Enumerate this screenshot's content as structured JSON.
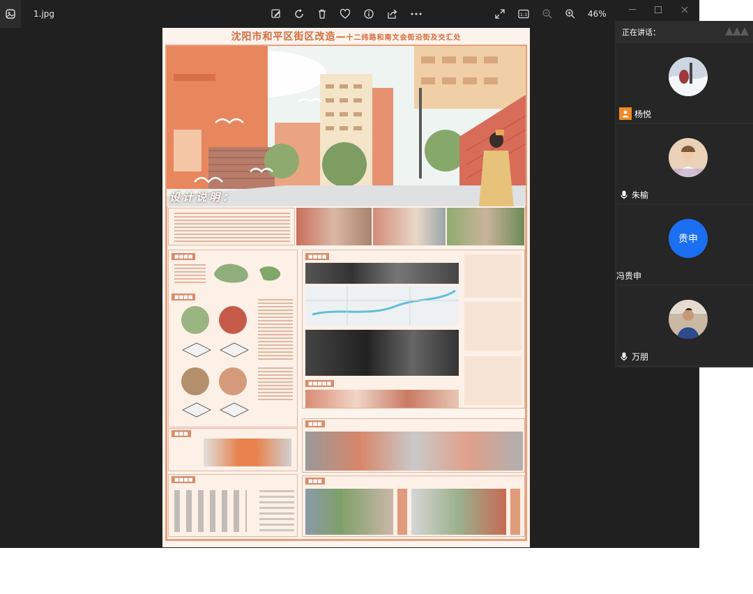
{
  "window": {
    "file_name": "1.jpg",
    "zoom_level": "46%",
    "icons": [
      "photos-app-icon",
      "edit-icon",
      "rotate-icon",
      "delete-icon",
      "favorite-icon",
      "info-icon",
      "share-icon",
      "more-icon",
      "fullscreen-icon",
      "actual-size-icon",
      "zoom-out-icon",
      "zoom-in-icon"
    ]
  },
  "poster": {
    "title_main": "沈阳市和平区街区改造",
    "title_dash": "—",
    "title_sub": "十二纬路和南文会街沿街及交汇处",
    "design_label": "设计说明："
  },
  "meeting": {
    "speaking_label": "正在讲话：",
    "participants": [
      {
        "name": "杨悦",
        "status_icon": "user-icon",
        "accent": "#f08a24"
      },
      {
        "name": "朱榆",
        "status_icon": "mic-icon"
      },
      {
        "name": "冯贵申",
        "avatar_text": "贵申",
        "avatar_color": "#1a6ff2"
      },
      {
        "name": "万朋",
        "status_icon": "mic-icon"
      }
    ]
  },
  "colors": {
    "poster_accent": "#d56a3c",
    "poster_frame": "#e8a07e",
    "viewer_bg": "#202020",
    "panel_bg": "#2d2d2d"
  }
}
